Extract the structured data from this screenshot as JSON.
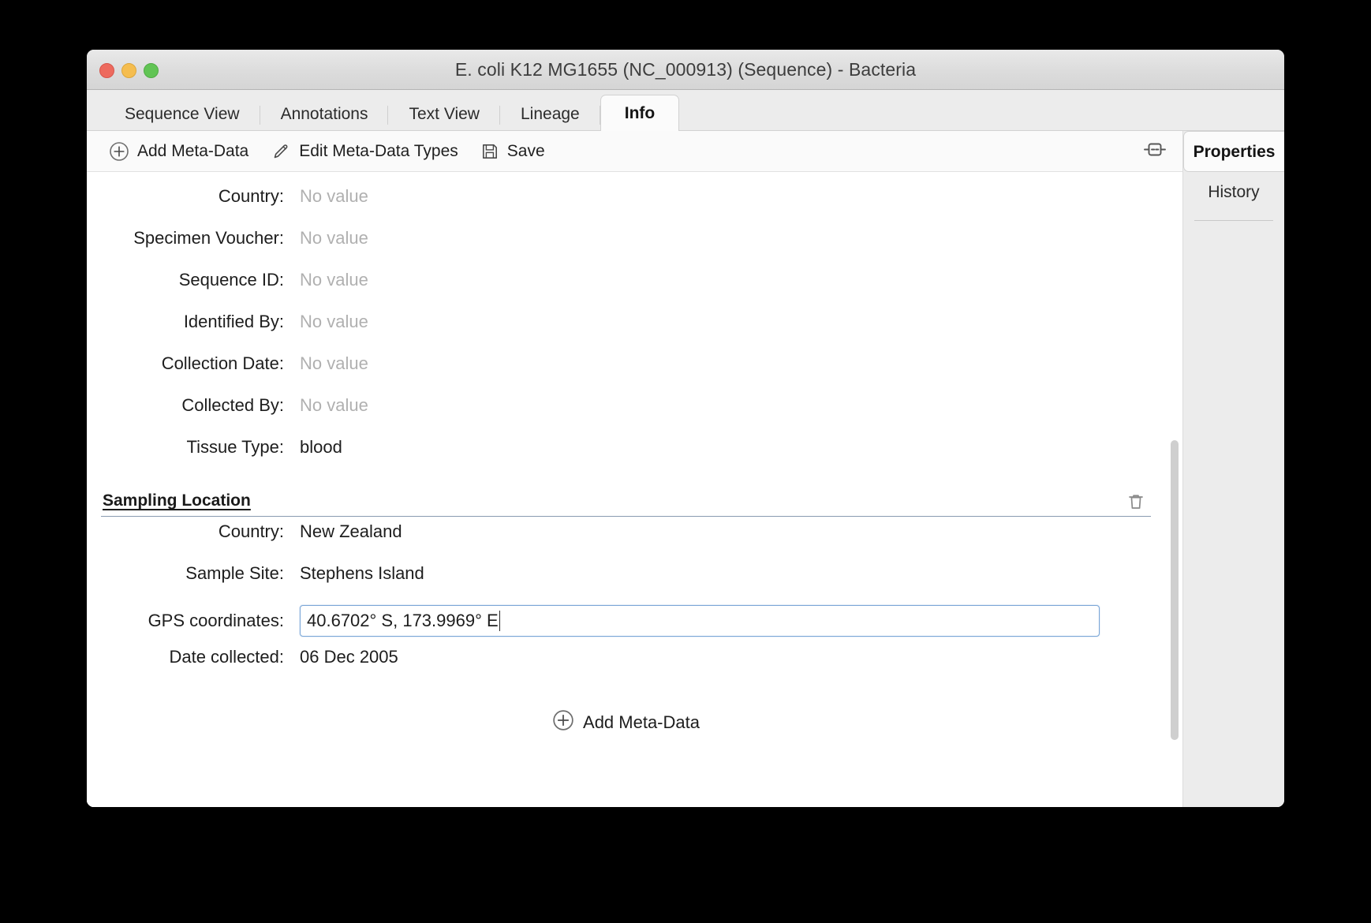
{
  "window": {
    "title": "E. coli K12 MG1655 (NC_000913) (Sequence) - Bacteria",
    "traffic_lights": {
      "close": "close-button",
      "minimize": "minimize-button",
      "zoom": "zoom-button"
    }
  },
  "tabs": [
    {
      "label": "Sequence View",
      "active": false
    },
    {
      "label": "Annotations",
      "active": false
    },
    {
      "label": "Text View",
      "active": false
    },
    {
      "label": "Lineage",
      "active": false
    },
    {
      "label": "Info",
      "active": true
    }
  ],
  "toolbar": {
    "add_meta_data": "Add Meta-Data",
    "edit_meta_data_types": "Edit Meta-Data Types",
    "save": "Save",
    "panel_toggle_icon": "split-panel-icon"
  },
  "dock": {
    "properties": "Properties",
    "history": "History"
  },
  "form": {
    "empty_placeholder": "No value",
    "top_rows": [
      {
        "label": "Country:",
        "value": "No value",
        "empty": true
      },
      {
        "label": "Specimen Voucher:",
        "value": "No value",
        "empty": true
      },
      {
        "label": "Sequence ID:",
        "value": "No value",
        "empty": true
      },
      {
        "label": "Identified By:",
        "value": "No value",
        "empty": true
      },
      {
        "label": "Collection Date:",
        "value": "No value",
        "empty": true
      },
      {
        "label": "Collected By:",
        "value": "No value",
        "empty": true
      },
      {
        "label": "Tissue Type:",
        "value": "blood",
        "empty": false
      }
    ],
    "section": {
      "title": "Sampling Location",
      "delete_icon": "trash-icon",
      "rows": [
        {
          "label": "Country:",
          "value": "New Zealand",
          "empty": false,
          "input": false
        },
        {
          "label": "Sample Site:",
          "value": "Stephens Island",
          "empty": false,
          "input": false
        },
        {
          "label": "GPS coordinates:",
          "value": "40.6702° S, 173.9969° E",
          "empty": false,
          "input": true,
          "focused": true
        },
        {
          "label": "Date collected:",
          "value": "06 Dec 2005",
          "empty": false,
          "input": false
        }
      ]
    },
    "add_meta_data_bottom": "Add Meta-Data"
  },
  "colors": {
    "focus_border": "#7ba7d7",
    "section_rule": "#8a9bb0",
    "placeholder_text": "#b0b0b0",
    "accent_red": "#ed6a5e",
    "accent_yellow": "#f5bd4f",
    "accent_green": "#61c454"
  }
}
